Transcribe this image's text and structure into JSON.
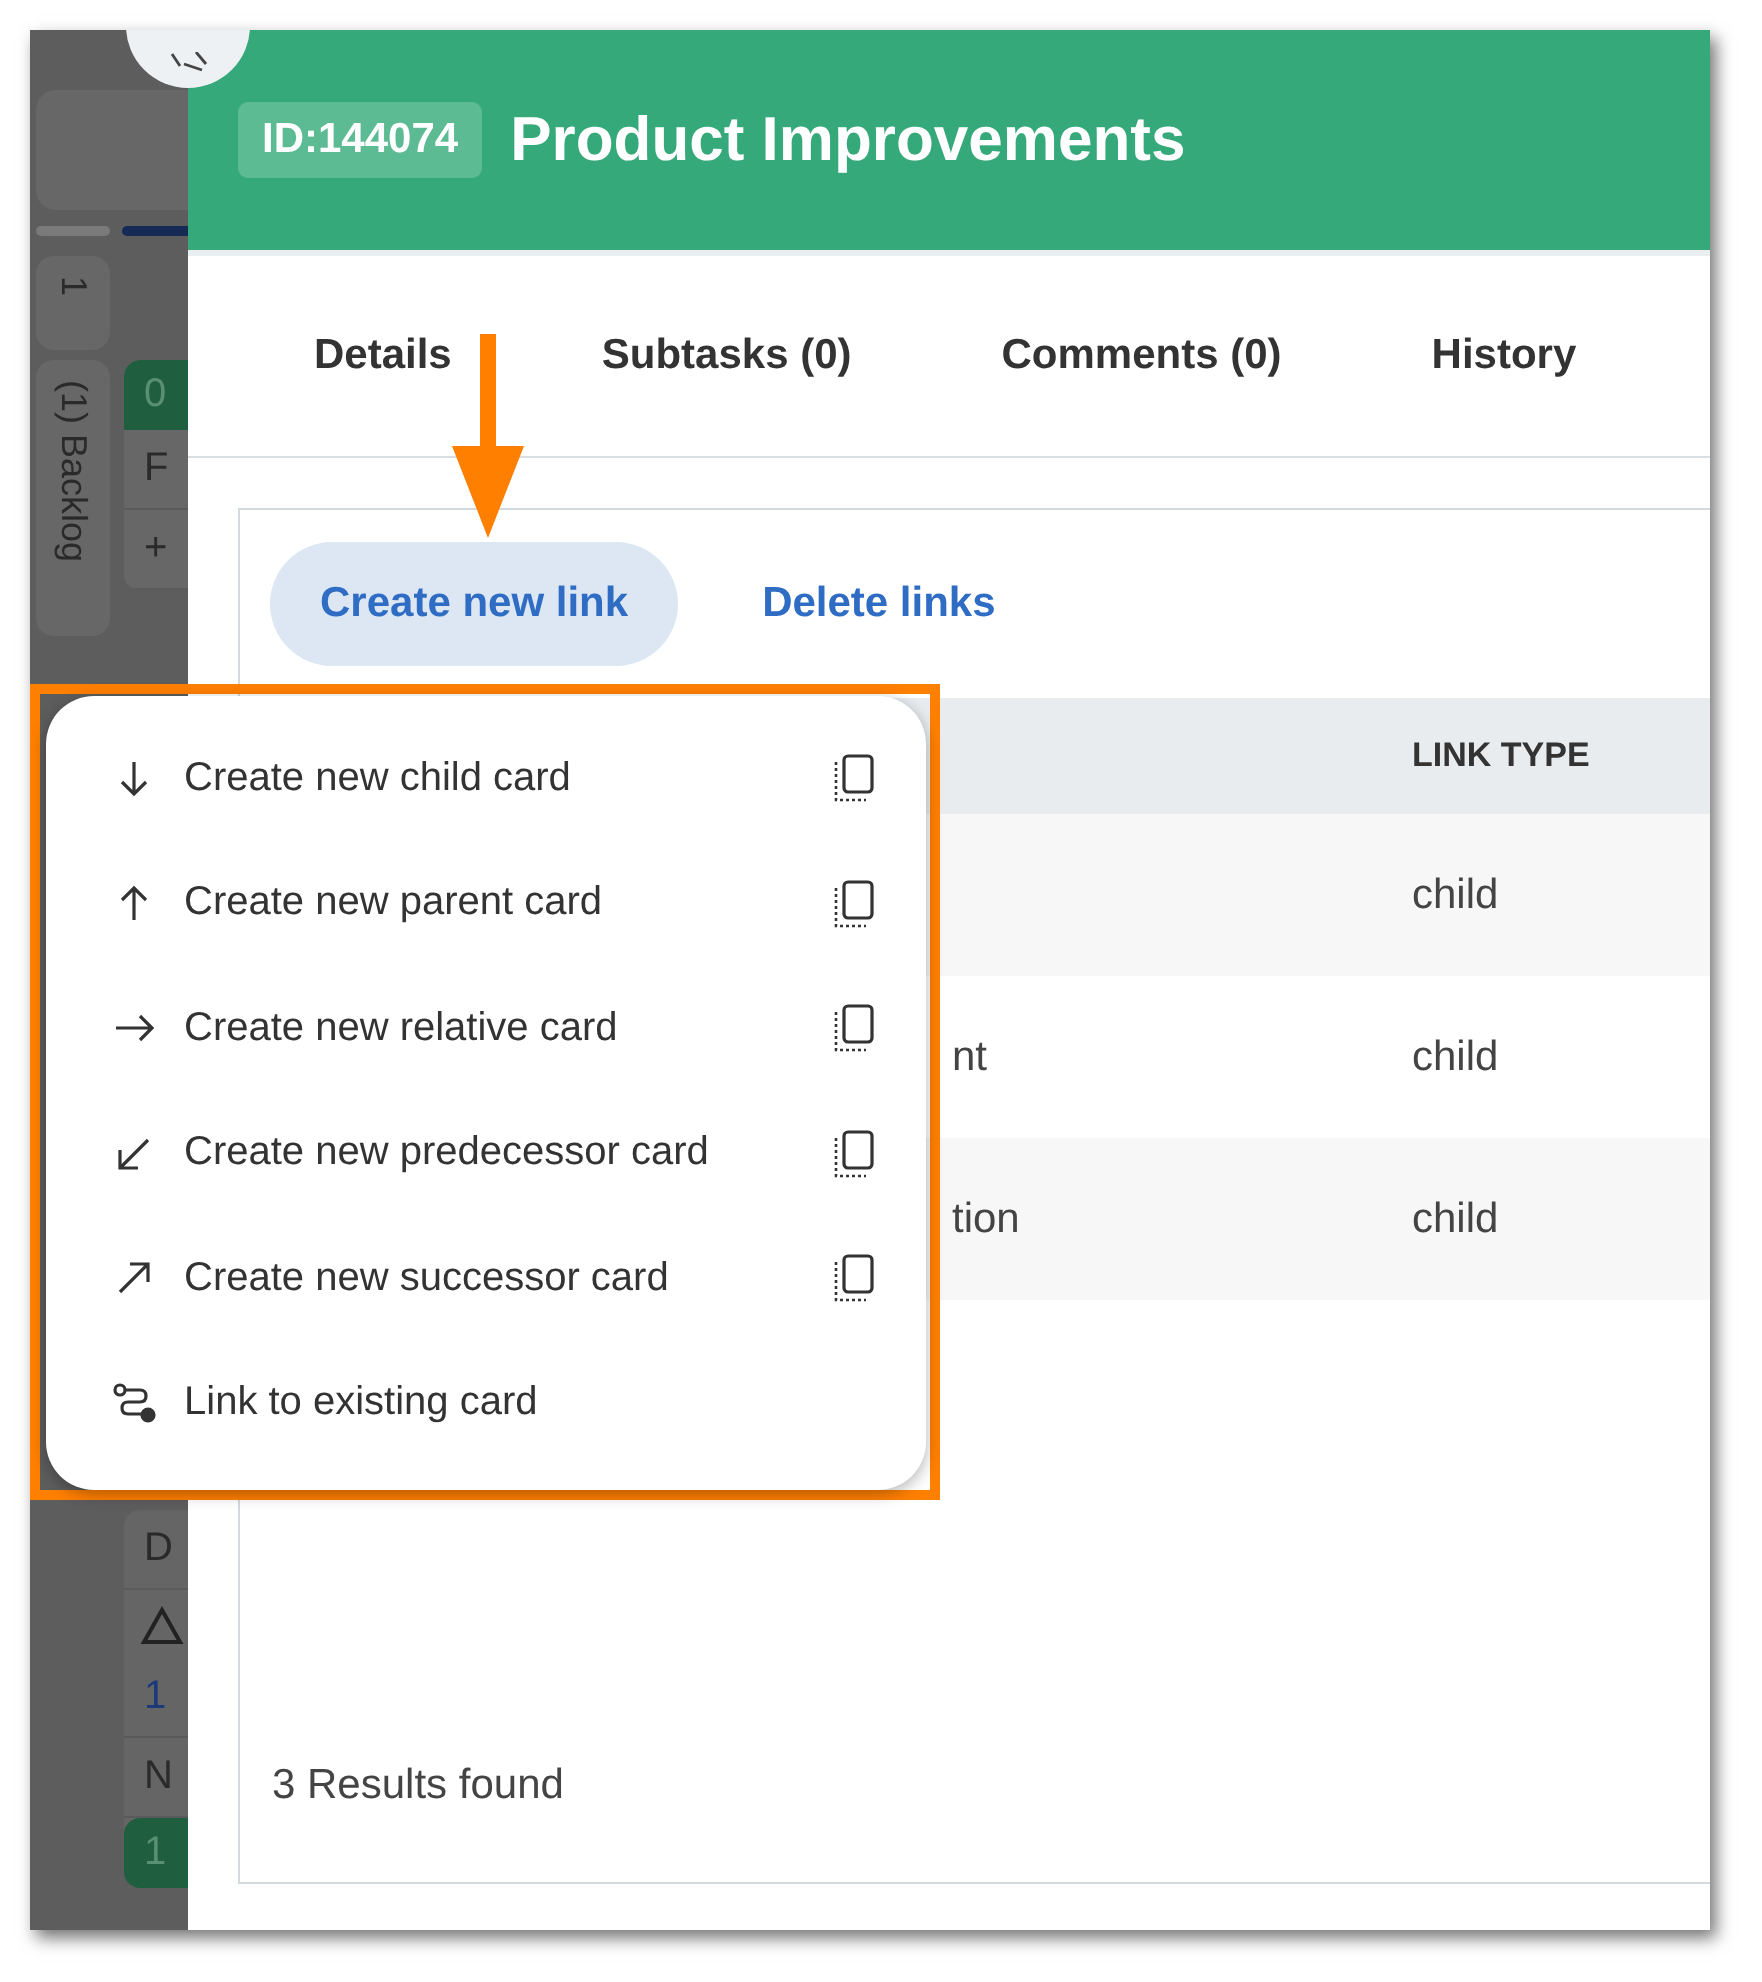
{
  "board": {
    "count": "1",
    "column_label": "(1) Backlog",
    "top_card": [
      {
        "kind": "header",
        "text": "0"
      },
      {
        "kind": "text",
        "text": "F"
      },
      {
        "kind": "text",
        "text": "+"
      }
    ],
    "bottom_card": [
      {
        "kind": "text",
        "text": "D"
      },
      {
        "kind": "warning"
      },
      {
        "kind": "link",
        "text": "1"
      },
      {
        "kind": "text",
        "text": "N"
      },
      {
        "kind": "header",
        "text": "1"
      }
    ]
  },
  "modal": {
    "id_badge": "ID:144074",
    "title": "Product Improvements",
    "tabs": [
      {
        "label": "Details"
      },
      {
        "label": "Subtasks (0)"
      },
      {
        "label": "Comments (0)"
      },
      {
        "label": "History"
      }
    ],
    "actions": {
      "primary": "Create new link",
      "secondary": "Delete links"
    },
    "table": {
      "columns": [
        "LINK TYPE"
      ],
      "rows": [
        {
          "link_type": "child"
        },
        {
          "column_1": "nt",
          "link_type": "child"
        },
        {
          "column_1": "tion",
          "link_type": "child"
        }
      ]
    },
    "results": "3 Results found"
  },
  "menu": {
    "items": [
      {
        "kind": "child",
        "label": "Create new child card",
        "copy_action": true
      },
      {
        "kind": "parent",
        "label": "Create new parent card",
        "copy_action": true
      },
      {
        "kind": "relative",
        "label": "Create new relative card",
        "copy_action": true
      },
      {
        "kind": "predecessor",
        "label": "Create new predecessor card",
        "copy_action": true
      },
      {
        "kind": "successor",
        "label": "Create new successor card",
        "copy_action": true
      },
      {
        "kind": "existing",
        "label": "Link to existing card",
        "copy_action": false
      }
    ]
  },
  "annotations": {
    "arrow": true,
    "highlight_box": true
  }
}
